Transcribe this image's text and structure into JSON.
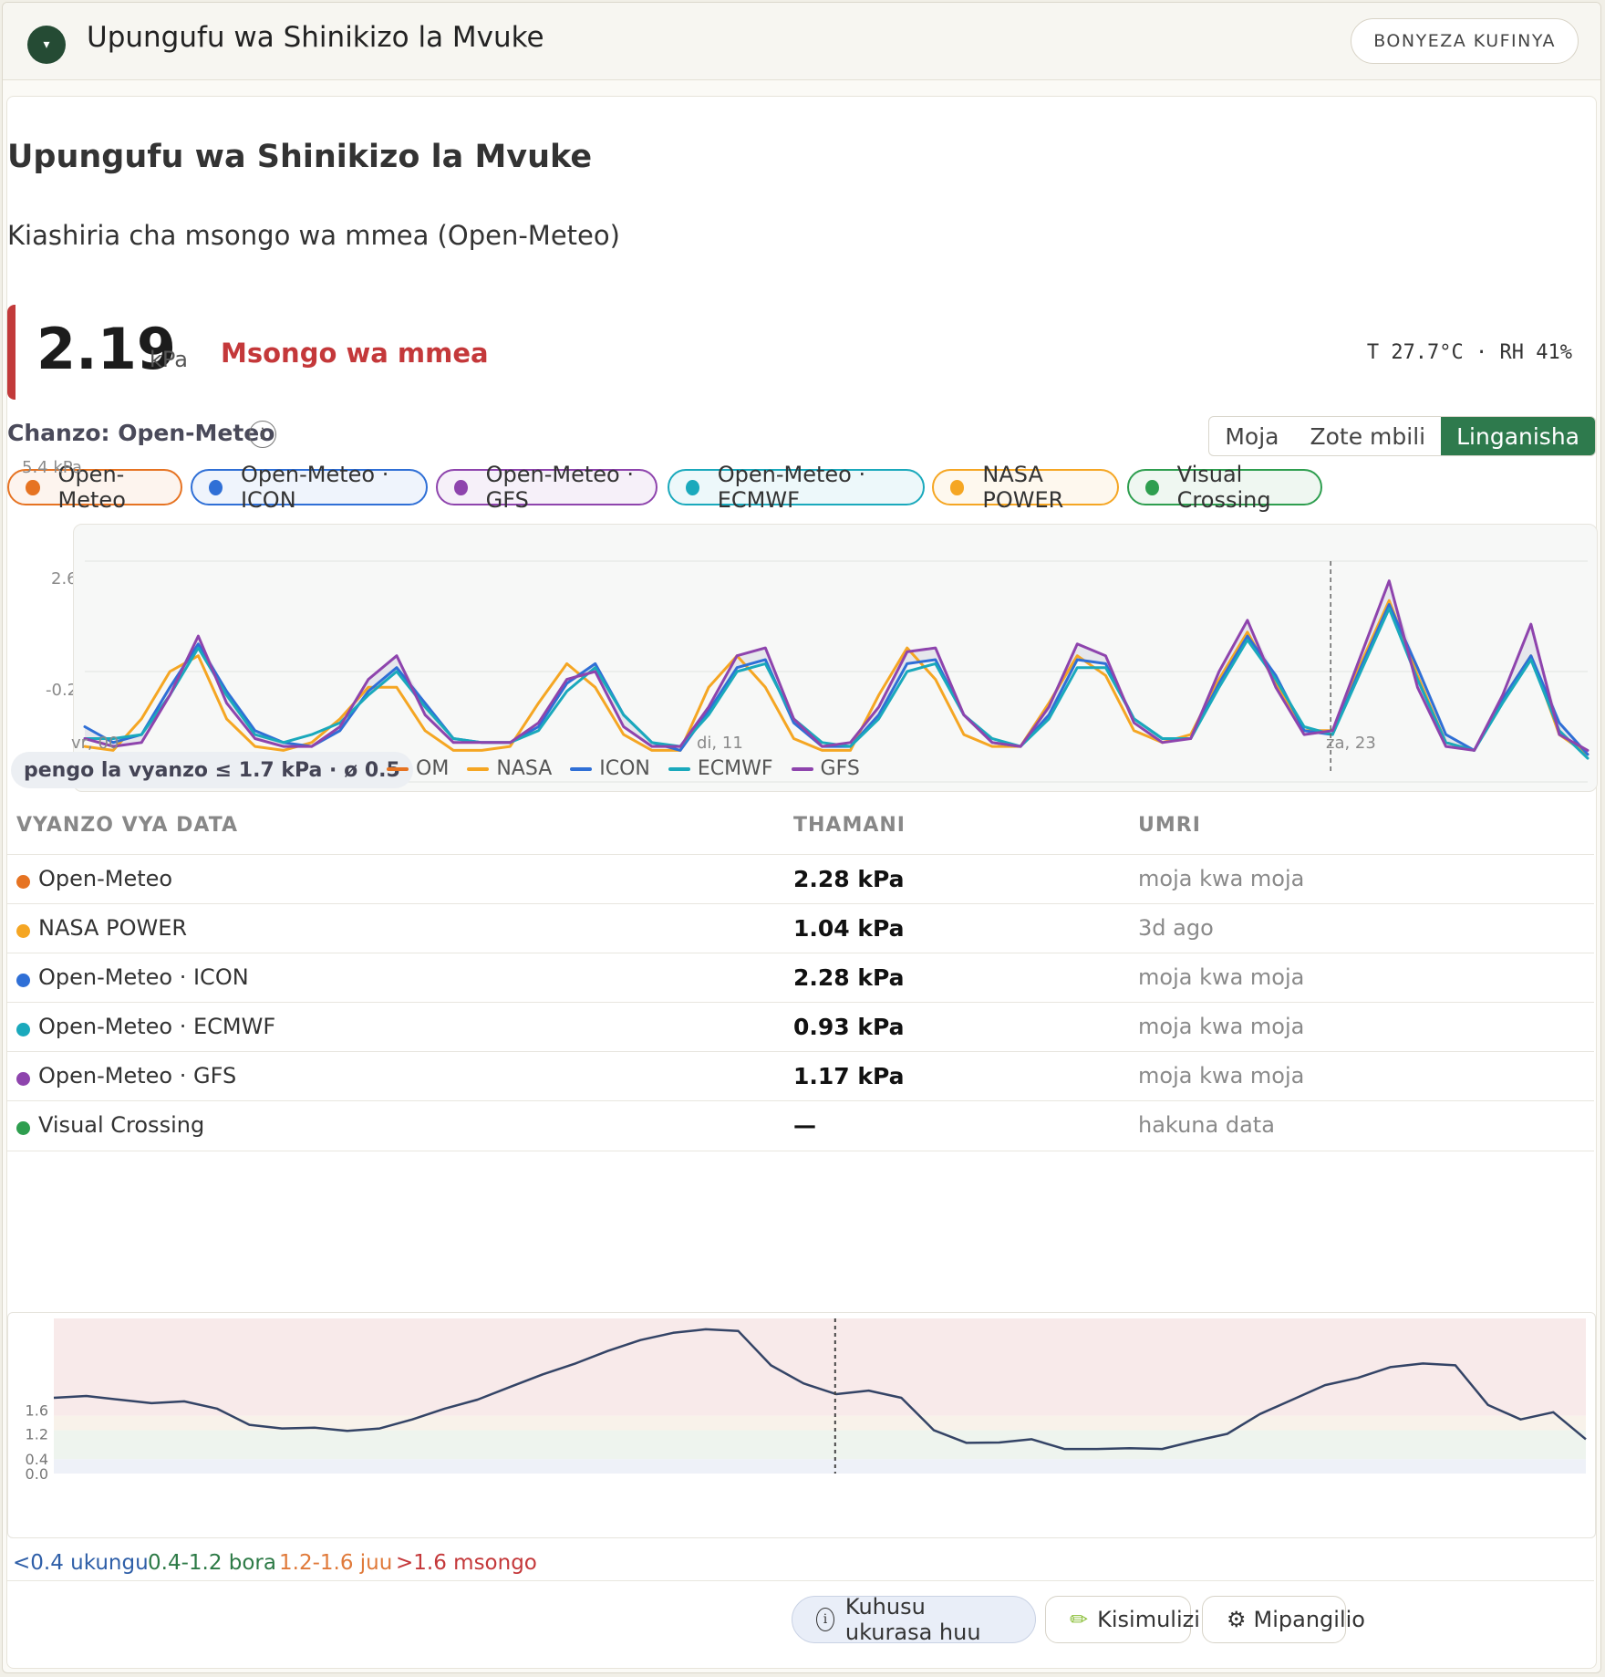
{
  "header": {
    "title": "Upungufu wa Shinikizo la Mvuke",
    "collapse_icon": "▾",
    "collapse_label": "BONYEZA KUFINYA"
  },
  "card": {
    "title": "Upungufu wa Shinikizo la Mvuke",
    "subtitle": "Kiashiria cha msongo wa mmea (Open-Meteo)",
    "value": "2.19",
    "unit": "kPa",
    "status": "Msongo wa mmea",
    "status_color": "#c4383a",
    "meta": "T 27.7°C · RH 41%",
    "source_label": "Chanzo: Open-Meteo",
    "info_icon": "i"
  },
  "mode_toggle": {
    "options": [
      "Moja",
      "Zote mbili",
      "Linganisha"
    ],
    "active": "Linganisha"
  },
  "source_chips": [
    {
      "label": "Open-Meteo",
      "color": "#e67322"
    },
    {
      "label": "Open-Meteo · ICON",
      "color": "#2f6fd6"
    },
    {
      "label": "Open-Meteo · GFS",
      "color": "#8e44ad"
    },
    {
      "label": "Open-Meteo · ECMWF",
      "color": "#1aa9bc"
    },
    {
      "label": "NASA POWER",
      "color": "#f5a623"
    },
    {
      "label": "Visual Crossing",
      "color": "#2e9e4f"
    }
  ],
  "chart_data": [
    {
      "type": "line",
      "y_tick_labels": [
        "5.4 kPa",
        "2.6",
        "-0.2"
      ],
      "ylim": [
        -0.2,
        5.4
      ],
      "x_tick_labels": [
        "vr, 00",
        "di, 11",
        "za, 23"
      ],
      "grid": true,
      "now_marker_fraction": 0.829,
      "gap_label": "pengo la vyanzo ≤ 1.7 kPa · ø 0.5",
      "series": [
        {
          "name": "OM",
          "color": "#e67322",
          "values": [
            0.8,
            0.7,
            1.0,
            2.3,
            3.2,
            1.8,
            0.9,
            0.6,
            0.6,
            1.0,
            2.2,
            2.8,
            1.6,
            0.8,
            0.7,
            0.7,
            1.3,
            2.5,
            2.4,
            1.3,
            0.7,
            0.8,
            1.8,
            2.8,
            2.6,
            1.2,
            0.6,
            0.7,
            1.6,
            2.9,
            2.7,
            1.4,
            0.8,
            0.7,
            1.6,
            3.0,
            2.6,
            1.2,
            0.8,
            0.9,
            2.5,
            3.7,
            2.3,
            1.1,
            1.1,
            2.8,
            4.5,
            2.6,
            0.8,
            0.6,
            1.9,
            3.1,
            1.1,
            0.5
          ]
        },
        {
          "name": "NASA",
          "color": "#f5a623",
          "values": [
            0.7,
            0.6,
            1.4,
            2.6,
            3.0,
            1.4,
            0.7,
            0.6,
            0.8,
            1.4,
            2.2,
            2.2,
            1.1,
            0.6,
            0.6,
            0.7,
            1.8,
            2.8,
            2.2,
            1.0,
            0.6,
            0.6,
            2.2,
            3.0,
            2.2,
            0.9,
            0.6,
            0.6,
            2.0,
            3.2,
            2.4,
            1.0,
            0.7,
            0.7,
            1.8,
            3.0,
            2.5,
            1.1,
            0.8,
            1.0,
            2.4,
            3.6,
            2.3,
            1.1,
            1.1,
            2.8,
            4.4,
            2.5,
            0.8,
            0.6,
            1.9,
            3.0,
            1.0,
            0.5
          ]
        },
        {
          "name": "ICON",
          "color": "#2f6fd6",
          "values": [
            1.2,
            0.8,
            1.0,
            2.2,
            3.3,
            2.1,
            1.1,
            0.8,
            0.7,
            1.1,
            2.1,
            2.7,
            1.8,
            0.9,
            0.8,
            0.8,
            1.2,
            2.3,
            2.8,
            1.5,
            0.8,
            0.6,
            1.6,
            2.7,
            2.9,
            1.3,
            0.7,
            0.7,
            1.5,
            2.8,
            2.9,
            1.5,
            0.8,
            0.7,
            1.5,
            2.9,
            2.8,
            1.4,
            0.9,
            0.9,
            2.3,
            3.5,
            2.5,
            1.1,
            1.0,
            2.7,
            4.3,
            2.7,
            1.0,
            0.6,
            1.9,
            3.0,
            1.3,
            0.5
          ]
        },
        {
          "name": "ECMWF",
          "color": "#1aa9bc",
          "values": [
            0.9,
            0.9,
            1.0,
            2.0,
            3.2,
            2.0,
            1.0,
            0.8,
            1.0,
            1.3,
            2.0,
            2.6,
            1.7,
            0.9,
            0.8,
            0.8,
            1.1,
            2.1,
            2.7,
            1.5,
            0.8,
            0.7,
            1.5,
            2.6,
            2.8,
            1.4,
            0.8,
            0.7,
            1.4,
            2.6,
            2.8,
            1.5,
            0.9,
            0.7,
            1.4,
            2.7,
            2.7,
            1.4,
            0.9,
            0.9,
            2.2,
            3.4,
            2.4,
            1.2,
            1.0,
            2.6,
            4.2,
            2.4,
            0.8,
            0.6,
            1.8,
            2.9,
            1.1,
            0.4
          ]
        },
        {
          "name": "GFS",
          "color": "#8e44ad",
          "values": [
            0.9,
            0.7,
            0.8,
            2.0,
            3.5,
            1.8,
            0.9,
            0.7,
            0.7,
            1.2,
            2.4,
            3.0,
            1.5,
            0.8,
            0.8,
            0.8,
            1.3,
            2.4,
            2.6,
            1.2,
            0.7,
            0.7,
            1.7,
            3.0,
            3.2,
            1.4,
            0.7,
            0.8,
            1.7,
            3.1,
            3.2,
            1.5,
            0.8,
            0.7,
            1.7,
            3.3,
            3.0,
            1.3,
            0.8,
            0.9,
            2.6,
            3.9,
            2.2,
            1.0,
            1.1,
            3.0,
            4.9,
            2.2,
            0.7,
            0.6,
            2.0,
            3.8,
            1.0,
            0.6
          ]
        }
      ]
    },
    {
      "type": "line",
      "y_tick_labels": [
        "1.6",
        "1.2",
        "0.4",
        "0.0"
      ],
      "zones": [
        {
          "from": 0.0,
          "to": 0.4,
          "color": "#eef1f8"
        },
        {
          "from": 0.4,
          "to": 1.2,
          "color": "#eef4ee"
        },
        {
          "from": 1.2,
          "to": 1.6,
          "color": "#f8f2ea"
        },
        {
          "from": 1.6,
          "to": 4.3,
          "color": "#f8eaea"
        }
      ],
      "ylim": [
        0.0,
        4.3
      ],
      "now_marker_fraction": 0.51,
      "series": [
        {
          "color": "#344466",
          "values": [
            2.1,
            2.15,
            2.05,
            1.95,
            2.0,
            1.8,
            1.35,
            1.25,
            1.27,
            1.18,
            1.25,
            1.5,
            1.8,
            2.05,
            2.4,
            2.75,
            3.05,
            3.4,
            3.7,
            3.9,
            4.0,
            3.95,
            3.0,
            2.5,
            2.2,
            2.3,
            2.1,
            1.2,
            0.85,
            0.86,
            0.95,
            0.68,
            0.68,
            0.7,
            0.68,
            0.9,
            1.1,
            1.65,
            2.05,
            2.45,
            2.65,
            2.95,
            3.05,
            3.0,
            1.9,
            1.5,
            1.7,
            0.95
          ]
        }
      ]
    }
  ],
  "table": {
    "headers": [
      "VYANZO VYA DATA",
      "THAMANI",
      "UMRI"
    ],
    "rows": [
      {
        "source": "Open-Meteo",
        "value": "2.28 kPa",
        "age": "moja kwa moja",
        "color": "#e67322"
      },
      {
        "source": "NASA POWER",
        "value": "1.04 kPa",
        "age": "3d ago",
        "color": "#f5a623"
      },
      {
        "source": "Open-Meteo · ICON",
        "value": "2.28 kPa",
        "age": "moja kwa moja",
        "color": "#2f6fd6"
      },
      {
        "source": "Open-Meteo · ECMWF",
        "value": "0.93 kPa",
        "age": "moja kwa moja",
        "color": "#1aa9bc"
      },
      {
        "source": "Open-Meteo · GFS",
        "value": "1.17 kPa",
        "age": "moja kwa moja",
        "color": "#8e44ad"
      },
      {
        "source": "Visual Crossing",
        "value": "—",
        "age": "hakuna data",
        "color": "#2e9e4f"
      }
    ]
  },
  "zones_legend": [
    {
      "label": "<0.4 ukungu",
      "color": "#2f5fa8"
    },
    {
      "label": "0.4-1.2 bora",
      "color": "#2d7a46"
    },
    {
      "label": "1.2-1.6 juu",
      "color": "#e07a3a"
    },
    {
      "label": ">1.6 msongo",
      "color": "#c4383a"
    }
  ],
  "footer": {
    "about": "Kuhusu ukurasa huu",
    "about_icon": "info-icon",
    "story": "Kisimulizi",
    "story_icon": "✏",
    "settings": "Mipangilio",
    "settings_icon": "⚙"
  }
}
